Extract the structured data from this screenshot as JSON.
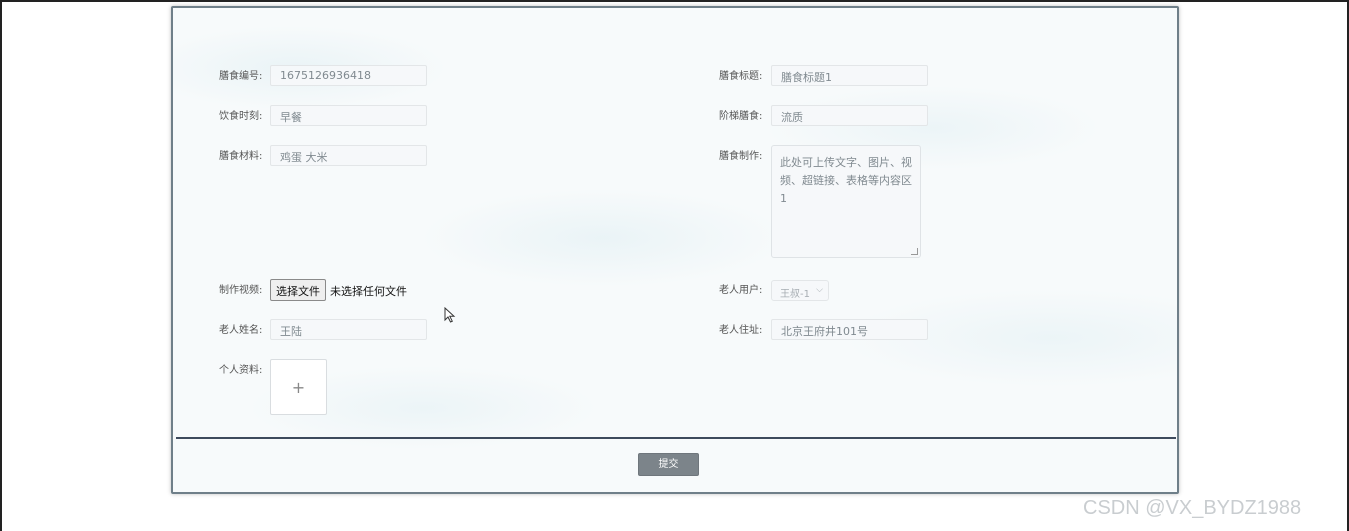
{
  "form": {
    "meal_id": {
      "label": "膳食编号:",
      "value": "1675126936418"
    },
    "meal_title": {
      "label": "膳食标题:",
      "value": "膳食标题1"
    },
    "meal_time": {
      "label": "饮食时刻:",
      "value": "早餐"
    },
    "ladder_meal": {
      "label": "阶梯膳食:",
      "value": "流质"
    },
    "meal_material": {
      "label": "膳食材料:",
      "value": "鸡蛋 大米"
    },
    "meal_make": {
      "label": "膳食制作:",
      "value": "此处可上传文字、图片、视频、超链接、表格等内容区1"
    },
    "video": {
      "label": "制作视频:",
      "button": "选择文件",
      "status": "未选择任何文件"
    },
    "elder_user": {
      "label": "老人用户:",
      "value": "王叔-1"
    },
    "elder_name": {
      "label": "老人姓名:",
      "value": "王陆"
    },
    "elder_address": {
      "label": "老人住址:",
      "value": "北京王府井101号"
    },
    "profile": {
      "label": "个人资料:",
      "upload_symbol": "+"
    }
  },
  "submit_label": "提交",
  "watermark": "CSDN @VX_BYDZ1988"
}
